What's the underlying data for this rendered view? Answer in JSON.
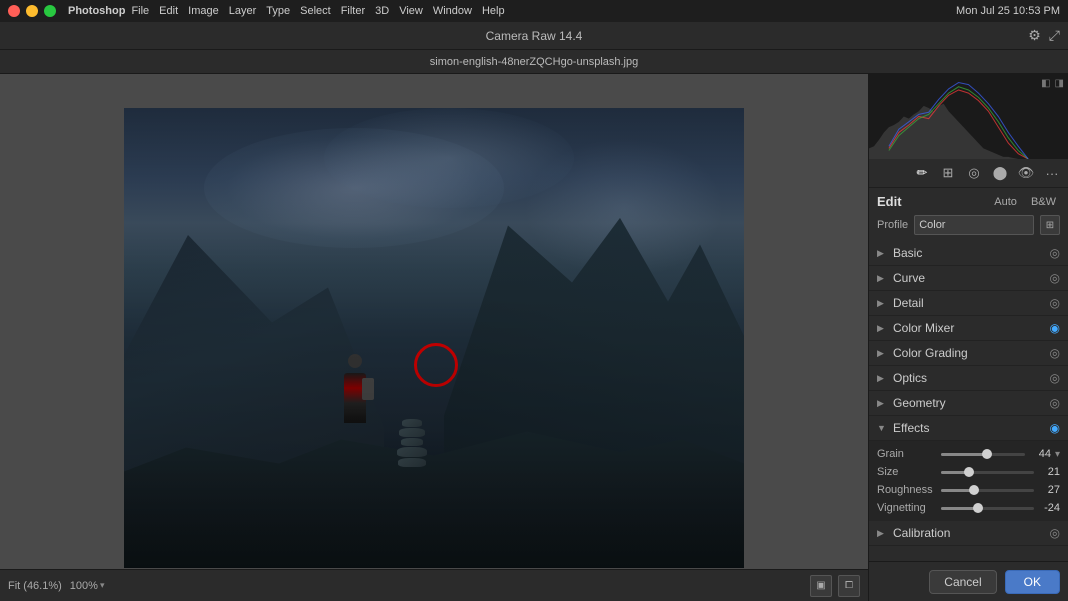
{
  "macbar": {
    "app": "Photoshop",
    "menu_items": [
      "Photoshop",
      "File",
      "Edit",
      "Image",
      "Layer",
      "Type",
      "Select",
      "Filter",
      "3D",
      "View",
      "Window",
      "Help"
    ],
    "time": "Mon Jul 25  10:53 PM",
    "traffic": [
      "red",
      "yellow",
      "green"
    ]
  },
  "titlebar": {
    "title": "Camera Raw 14.4"
  },
  "filename": {
    "name": "simon-english-48nerZQCHgo-unsplash.jpg"
  },
  "bottom_bar": {
    "fit_label": "Fit (46.1%)",
    "zoom_value": "100%"
  },
  "right_panel": {
    "edit_label": "Edit",
    "auto_btn": "Auto",
    "bw_btn": "B&W",
    "profile_label": "Profile",
    "profile_value": "Color",
    "sections": [
      {
        "name": "Basic",
        "expanded": false,
        "active": false
      },
      {
        "name": "Curve",
        "expanded": false,
        "active": false
      },
      {
        "name": "Detail",
        "expanded": false,
        "active": false
      },
      {
        "name": "Color Mixer",
        "expanded": false,
        "active": true
      },
      {
        "name": "Color Grading",
        "expanded": false,
        "active": false
      },
      {
        "name": "Optics",
        "expanded": false,
        "active": false
      },
      {
        "name": "Geometry",
        "expanded": false,
        "active": false
      },
      {
        "name": "Effects",
        "expanded": true,
        "active": true
      }
    ],
    "effects": {
      "grain_label": "Grain",
      "grain_value": "44",
      "grain_pct": 55,
      "size_label": "Size",
      "size_value": "21",
      "size_pct": 30,
      "roughness_label": "Roughness",
      "roughness_value": "27",
      "roughness_pct": 35,
      "vignetting_label": "Vignetting",
      "vignetting_value": "-24",
      "vignetting_pct": 40
    },
    "calibration_label": "Calibration"
  },
  "actions": {
    "cancel": "Cancel",
    "ok": "OK"
  }
}
